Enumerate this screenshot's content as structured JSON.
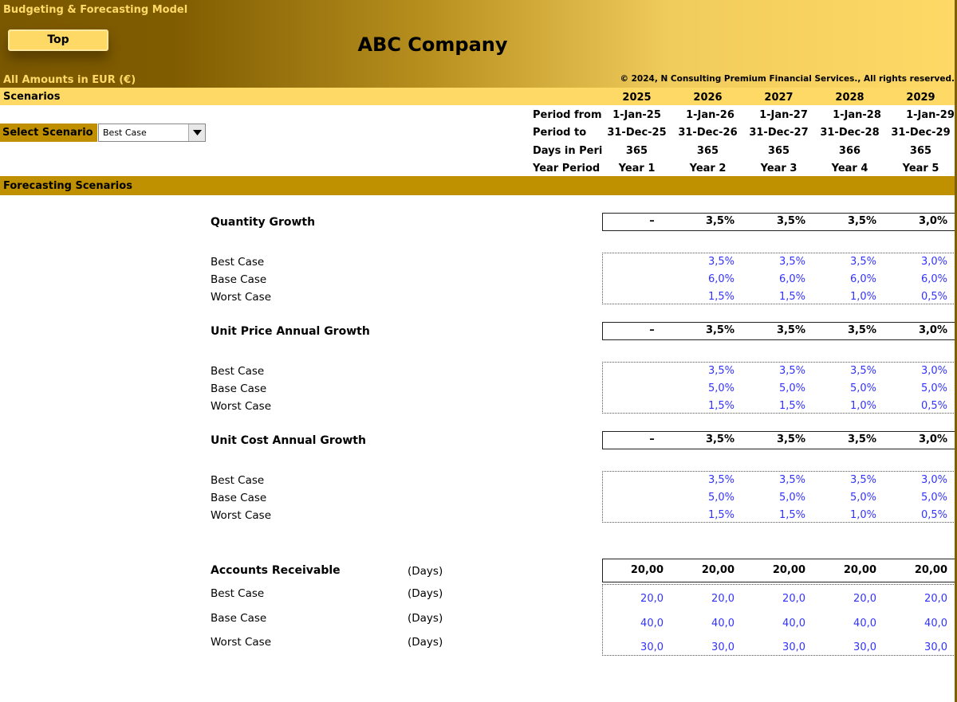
{
  "header": {
    "model_title": "Budgeting & Forecasting  Model",
    "top_button": "Top",
    "company": "ABC Company",
    "amounts_note": "All Amounts in  EUR (€)",
    "copyright": "© 2024, N Consulting Premium Financial Services., All rights reserved."
  },
  "colors": {
    "header_dark": "#7a5800",
    "header_light": "#ffd966",
    "section_bar": "#bf9000",
    "input_blue": "#3333ff"
  },
  "scenarios_bar": {
    "label": "Scenarios",
    "years": [
      "2025",
      "2026",
      "2027",
      "2028",
      "2029"
    ]
  },
  "periods": [
    {
      "label": "Period from",
      "values": [
        "1-Jan-25",
        "1-Jan-26",
        "1-Jan-27",
        "1-Jan-28",
        "1-Jan-29"
      ]
    },
    {
      "label": "Period to",
      "values": [
        "31-Dec-25",
        "31-Dec-26",
        "31-Dec-27",
        "31-Dec-28",
        "31-Dec-29"
      ]
    },
    {
      "label": "Days in Period",
      "values": [
        "365",
        "365",
        "365",
        "366",
        "365"
      ]
    },
    {
      "label": "Year Period",
      "values": [
        "Year 1",
        "Year 2",
        "Year 3",
        "Year 4",
        "Year 5"
      ]
    }
  ],
  "select": {
    "label": "Select Scenario",
    "value": "Best Case",
    "icon": "dropdown-arrow-icon"
  },
  "forecasting_bar": "Forecasting Scenarios",
  "sections": [
    {
      "title": "Quantity Growth",
      "unit": "",
      "summary": [
        "–",
        "3,5%",
        "3,5%",
        "3,5%",
        "3,0%"
      ],
      "rows": [
        {
          "label": "Best Case",
          "values": [
            "",
            "3,5%",
            "3,5%",
            "3,5%",
            "3,0%"
          ]
        },
        {
          "label": "Base Case",
          "values": [
            "",
            "6,0%",
            "6,0%",
            "6,0%",
            "6,0%"
          ]
        },
        {
          "label": "Worst Case",
          "values": [
            "",
            "1,5%",
            "1,5%",
            "1,0%",
            "0,5%"
          ]
        }
      ]
    },
    {
      "title": "Unit Price Annual Growth",
      "unit": "",
      "summary": [
        "–",
        "3,5%",
        "3,5%",
        "3,5%",
        "3,0%"
      ],
      "rows": [
        {
          "label": "Best Case",
          "values": [
            "",
            "3,5%",
            "3,5%",
            "3,5%",
            "3,0%"
          ]
        },
        {
          "label": "Base Case",
          "values": [
            "",
            "5,0%",
            "5,0%",
            "5,0%",
            "5,0%"
          ]
        },
        {
          "label": "Worst Case",
          "values": [
            "",
            "1,5%",
            "1,5%",
            "1,0%",
            "0,5%"
          ]
        }
      ]
    },
    {
      "title": "Unit Cost Annual Growth",
      "unit": "",
      "summary": [
        "–",
        "3,5%",
        "3,5%",
        "3,5%",
        "3,0%"
      ],
      "rows": [
        {
          "label": "Best Case",
          "values": [
            "",
            "3,5%",
            "3,5%",
            "3,5%",
            "3,0%"
          ]
        },
        {
          "label": "Base Case",
          "values": [
            "",
            "5,0%",
            "5,0%",
            "5,0%",
            "5,0%"
          ]
        },
        {
          "label": "Worst Case",
          "values": [
            "",
            "1,5%",
            "1,5%",
            "1,0%",
            "0,5%"
          ]
        }
      ]
    },
    {
      "title": "Accounts Receivable",
      "unit": "(Days)",
      "summary": [
        "20,00",
        "20,00",
        "20,00",
        "20,00",
        "20,00"
      ],
      "rows": [
        {
          "label": "Best Case",
          "unit": "(Days)",
          "values": [
            "20,0",
            "20,0",
            "20,0",
            "20,0",
            "20,0"
          ]
        },
        {
          "label": "Base Case",
          "unit": "(Days)",
          "values": [
            "40,0",
            "40,0",
            "40,0",
            "40,0",
            "40,0"
          ]
        },
        {
          "label": "Worst Case",
          "unit": "(Days)",
          "values": [
            "30,0",
            "30,0",
            "30,0",
            "30,0",
            "30,0"
          ]
        }
      ]
    }
  ]
}
